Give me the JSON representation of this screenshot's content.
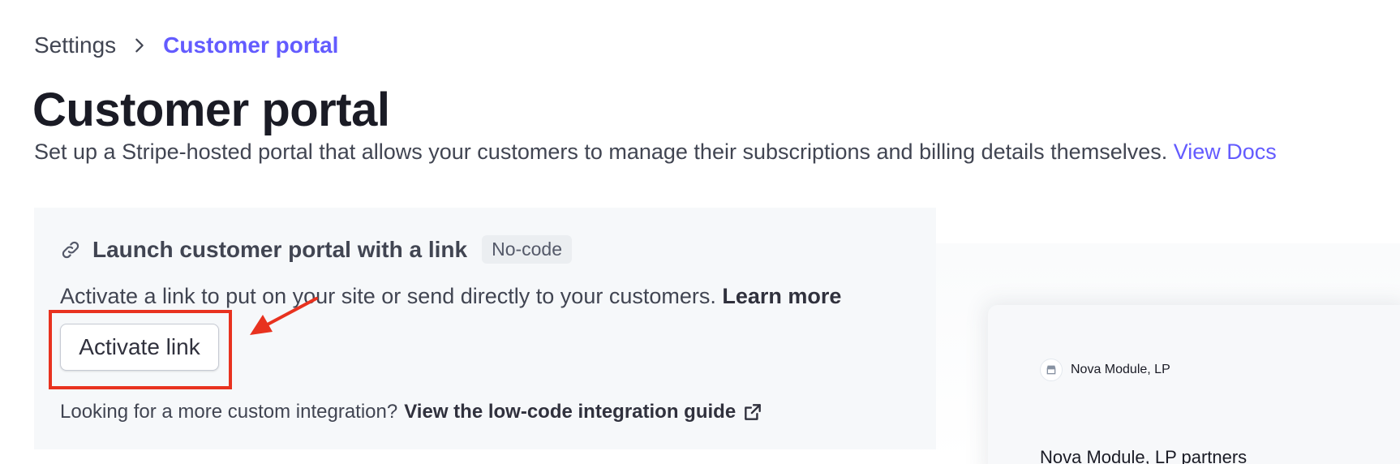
{
  "breadcrumb": {
    "root": "Settings",
    "current": "Customer portal",
    "separator_icon": "chevron-right-icon"
  },
  "page": {
    "title": "Customer portal",
    "subtitle": "Set up a Stripe-hosted portal that allows your customers to manage their subscriptions and billing details themselves.",
    "docs_link": "View Docs"
  },
  "card": {
    "icon": "link-icon",
    "title": "Launch customer portal with a link",
    "badge": "No-code",
    "description": "Activate a link to put on your site or send directly to your customers.",
    "learn_more": "Learn more",
    "activate_button": "Activate link",
    "footer_text": "Looking for a more custom integration?",
    "footer_link": "View the low-code integration guide",
    "footer_link_icon": "external-link-icon"
  },
  "preview": {
    "merchant_name": "Nova Module, LP",
    "heading": "Nova Module, LP partners",
    "store_icon": "store-icon"
  },
  "colors": {
    "accent": "#635bff",
    "annotation": "#e8321f",
    "card_background": "#f6f8fa"
  }
}
